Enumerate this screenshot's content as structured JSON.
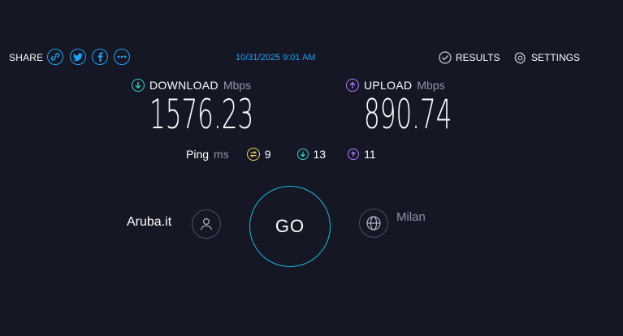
{
  "header": {
    "share_label": "SHARE",
    "share_buttons": [
      {
        "icon": "link-icon",
        "label": "link"
      },
      {
        "icon": "twitter-icon",
        "label": "twitter"
      },
      {
        "icon": "facebook-icon",
        "label": "facebook"
      },
      {
        "icon": "more-icon",
        "label": "more"
      }
    ],
    "timestamp": "10/31/2025 9:01 AM",
    "results_label": "RESULTS",
    "settings_label": "SETTINGS"
  },
  "download": {
    "label": "DOWNLOAD",
    "unit": "Mbps",
    "value": "1576.23",
    "icon": "download-arrow-icon",
    "color": "#37d3c8"
  },
  "upload": {
    "label": "UPLOAD",
    "unit": "Mbps",
    "value": "890.74",
    "icon": "upload-arrow-icon",
    "color": "#b57cff"
  },
  "ping": {
    "label": "Ping",
    "unit": "ms",
    "idle": {
      "value": "9",
      "icon": "idle-latency-icon",
      "color": "#f5d65c"
    },
    "download": {
      "value": "13",
      "icon": "download-latency-icon",
      "color": "#37d3c8"
    },
    "upload": {
      "value": "11",
      "icon": "upload-latency-icon",
      "color": "#b57cff"
    }
  },
  "isp": {
    "name": "Aruba.it",
    "icon": "user-icon"
  },
  "server": {
    "name": "Milan",
    "icon": "globe-icon"
  },
  "go_label": "GO",
  "colors": {
    "background": "#151725",
    "accent": "#1ea1f2",
    "go_ring": "#1eb8d6",
    "muted_text": "#9193a8"
  }
}
